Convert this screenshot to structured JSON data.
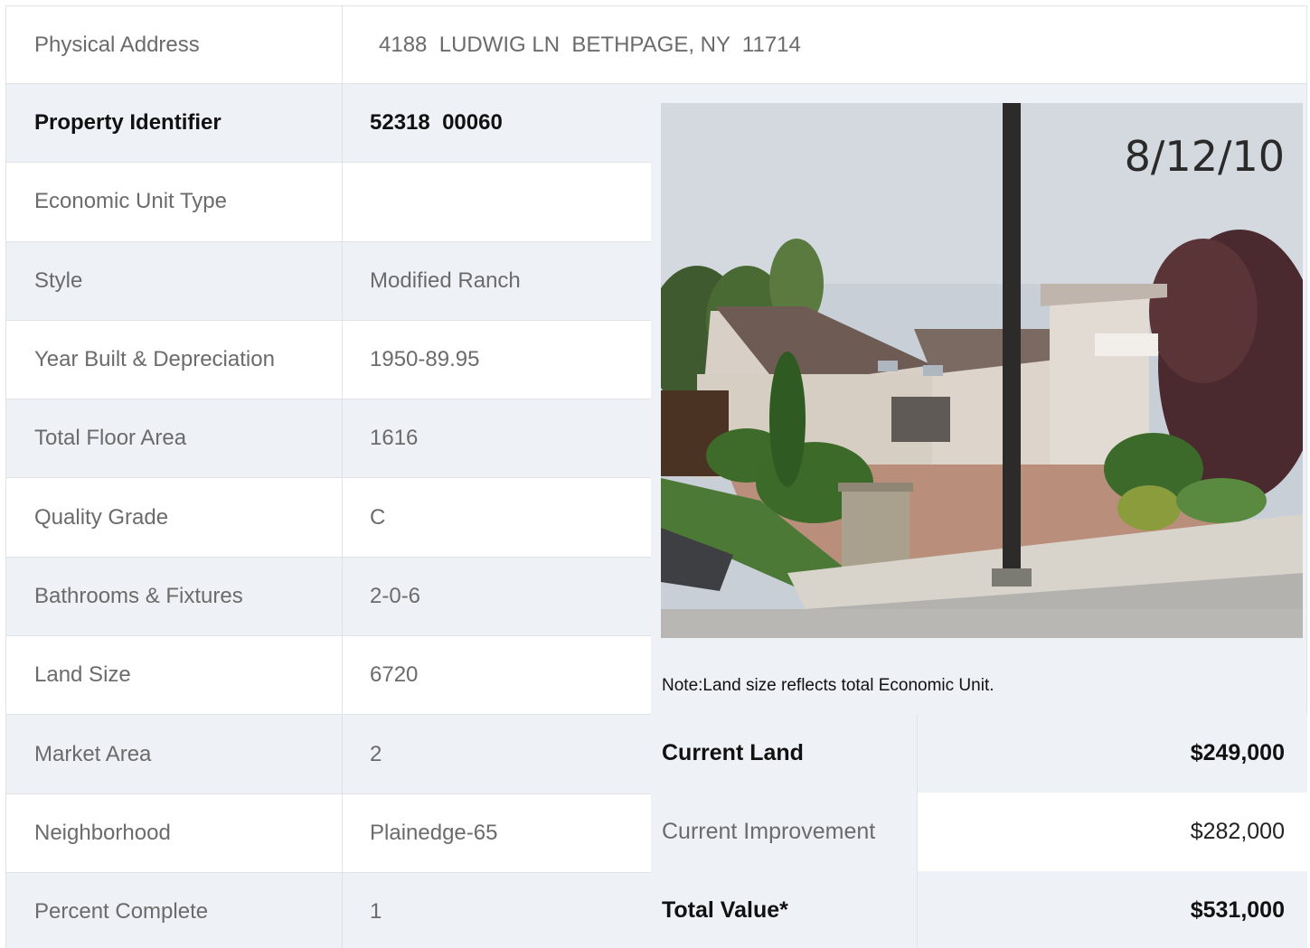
{
  "address": {
    "label": "Physical Address",
    "value": "4188  LUDWIG LN  BETHPAGE, NY  11714"
  },
  "details": [
    {
      "label": "Property Identifier",
      "value": "52318  00060",
      "bold": true
    },
    {
      "label": "Economic Unit Type",
      "value": ""
    },
    {
      "label": "Style",
      "value": "Modified Ranch"
    },
    {
      "label": "Year Built & Depreciation",
      "value": "1950-89.95"
    },
    {
      "label": "Total Floor Area",
      "value": "1616"
    },
    {
      "label": "Quality Grade",
      "value": "C"
    },
    {
      "label": "Bathrooms & Fixtures",
      "value": "2-0-6"
    },
    {
      "label": "Land Size",
      "value": "6720"
    },
    {
      "label": "Market Area",
      "value": "2"
    },
    {
      "label": "Neighborhood",
      "value": "Plainedge-65"
    },
    {
      "label": "Percent Complete",
      "value": "1"
    }
  ],
  "photo": {
    "date_stamp": "8/12/10"
  },
  "note": "Note:Land size reflects total Economic Unit.",
  "values": {
    "land": {
      "label": "Current Land",
      "value": "$249,000"
    },
    "improvement": {
      "label": "Current Improvement",
      "value": "$282,000"
    },
    "total": {
      "label": "Total Value*",
      "value": "$531,000"
    }
  }
}
